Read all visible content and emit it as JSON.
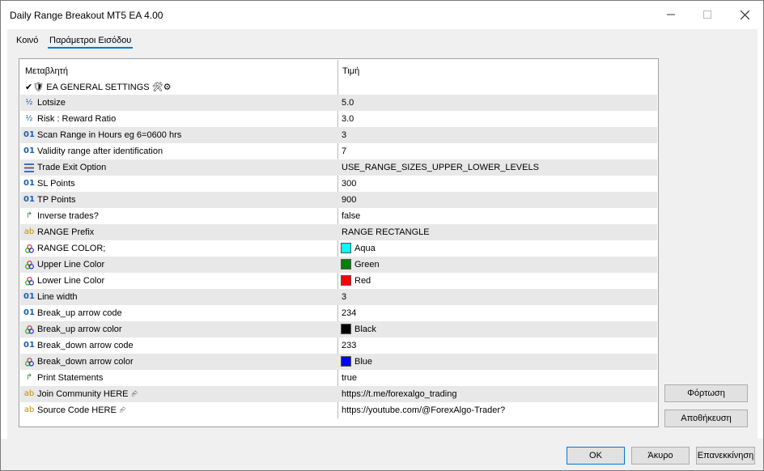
{
  "window": {
    "title": "Daily Range Breakout MT5 EA 4.00"
  },
  "backdrop_colors": [
    "#000000",
    "#1f9b1f",
    "#000000",
    "#1f9b1f",
    "#000000",
    "#1f9b1f",
    "#000000",
    "#1f9b1f",
    "#000000",
    "#1f9b1f"
  ],
  "tabs": [
    {
      "label": "Κοινό",
      "active": false
    },
    {
      "label": "Παράμετροι Εισόδου",
      "active": true
    }
  ],
  "grid": {
    "col_name": "Μεταβλητή",
    "col_value": "Τιμή",
    "rows": [
      {
        "icon": "check-shield",
        "name": "✔🛡 EA GENERAL SETTINGS 🛠⚙",
        "value": "",
        "group": true
      },
      {
        "icon": "half",
        "name": "Lotsize",
        "value": "5.0"
      },
      {
        "icon": "half",
        "name": "Risk : Reward Ratio",
        "value": "3.0"
      },
      {
        "icon": "int",
        "name": "Scan Range in Hours eg 6=0600 hrs",
        "value": "3"
      },
      {
        "icon": "int",
        "name": "Validity range after identification",
        "value": "7"
      },
      {
        "icon": "enum",
        "name": "Trade Exit Option",
        "value": "USE_RANGE_SIZES_UPPER_LOWER_LEVELS"
      },
      {
        "icon": "int",
        "name": "SL Points",
        "value": "300"
      },
      {
        "icon": "int",
        "name": "TP Points",
        "value": "900"
      },
      {
        "icon": "bool",
        "name": "Inverse trades?",
        "value": "false"
      },
      {
        "icon": "string",
        "name": "RANGE Prefix",
        "value": "RANGE RECTANGLE"
      },
      {
        "icon": "color",
        "name": "RANGE COLOR;",
        "value": "Aqua",
        "swatch": "#00ffff"
      },
      {
        "icon": "color",
        "name": "Upper Line Color",
        "value": "Green",
        "swatch": "#008000"
      },
      {
        "icon": "color",
        "name": "Lower Line Color",
        "value": "Red",
        "swatch": "#ff0000"
      },
      {
        "icon": "int",
        "name": "Line width",
        "value": "3"
      },
      {
        "icon": "int",
        "name": "Break_up arrow code",
        "value": "234"
      },
      {
        "icon": "color",
        "name": "Break_up arrow color",
        "value": "Black",
        "swatch": "#000000"
      },
      {
        "icon": "int",
        "name": "Break_down arrow code",
        "value": "233"
      },
      {
        "icon": "color",
        "name": "Break_down arrow color",
        "value": "Blue",
        "swatch": "#0000ff"
      },
      {
        "icon": "bool",
        "name": "Print Statements",
        "value": "true"
      },
      {
        "icon": "string",
        "name": "Join Community HERE",
        "value": "https://t.me/forexalgo_trading",
        "link": true
      },
      {
        "icon": "string",
        "name": "Source Code HERE",
        "value": "https://youtube.com/@ForexAlgo-Trader?",
        "link": true
      }
    ]
  },
  "side_buttons": {
    "load": "Φόρτωση",
    "save": "Αποθήκευση"
  },
  "footer_buttons": {
    "ok": "OK",
    "cancel": "Άκυρο",
    "reset": "Επανεκκίνηση"
  },
  "icons": {
    "int": "01",
    "half": "½",
    "string": "ab",
    "bool": "↱",
    "color": "✿",
    "enum": "☰"
  },
  "accent_color": "#0078d7"
}
